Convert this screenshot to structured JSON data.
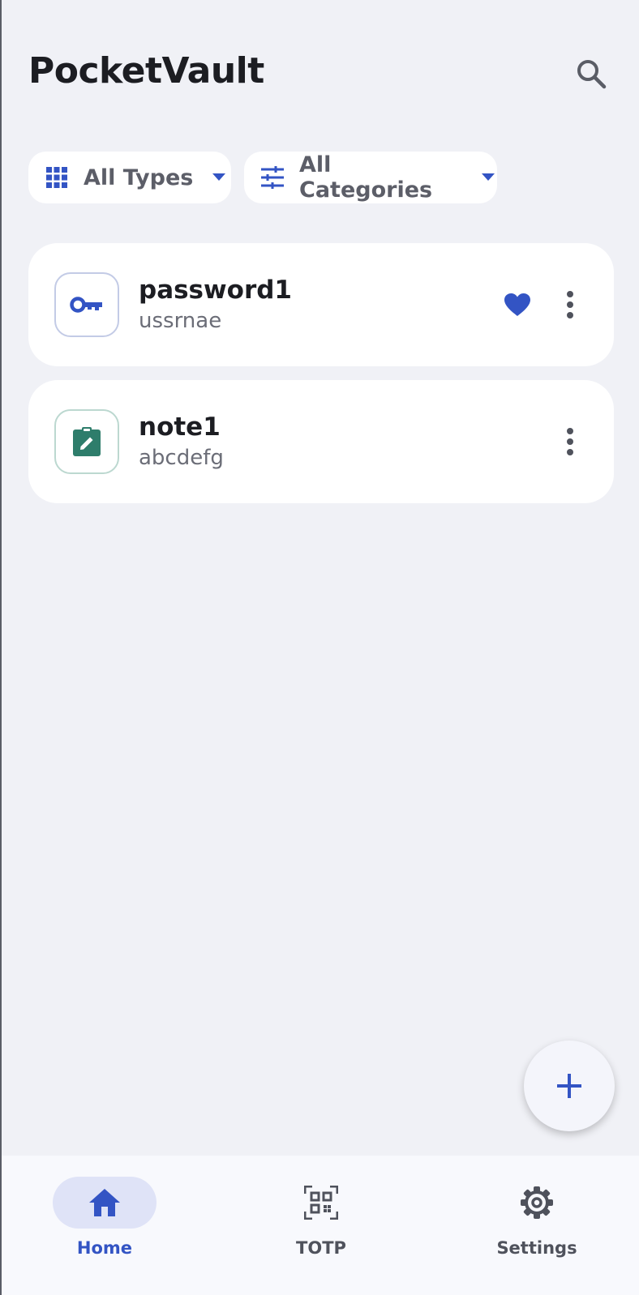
{
  "header": {
    "title": "PocketVault",
    "search_icon": "search-icon"
  },
  "filters": {
    "types": {
      "label": "All Types",
      "icon": "grid-icon"
    },
    "categories": {
      "label": "All Categories",
      "icon": "tune-icon"
    }
  },
  "items": [
    {
      "title": "password1",
      "subtitle": "ussrnae",
      "type_icon": "key-icon",
      "favorite": true
    },
    {
      "title": "note1",
      "subtitle": "abcdefg",
      "type_icon": "note-icon",
      "favorite": false
    }
  ],
  "fab": {
    "icon": "plus-icon"
  },
  "nav": {
    "items": [
      {
        "label": "Home",
        "icon": "home-icon",
        "active": true
      },
      {
        "label": "TOTP",
        "icon": "qr-code-icon",
        "active": false
      },
      {
        "label": "Settings",
        "icon": "gear-icon",
        "active": false
      }
    ]
  },
  "colors": {
    "accent": "#3354c4",
    "note_accent": "#2e7d6b",
    "background": "#f0f1f6"
  }
}
